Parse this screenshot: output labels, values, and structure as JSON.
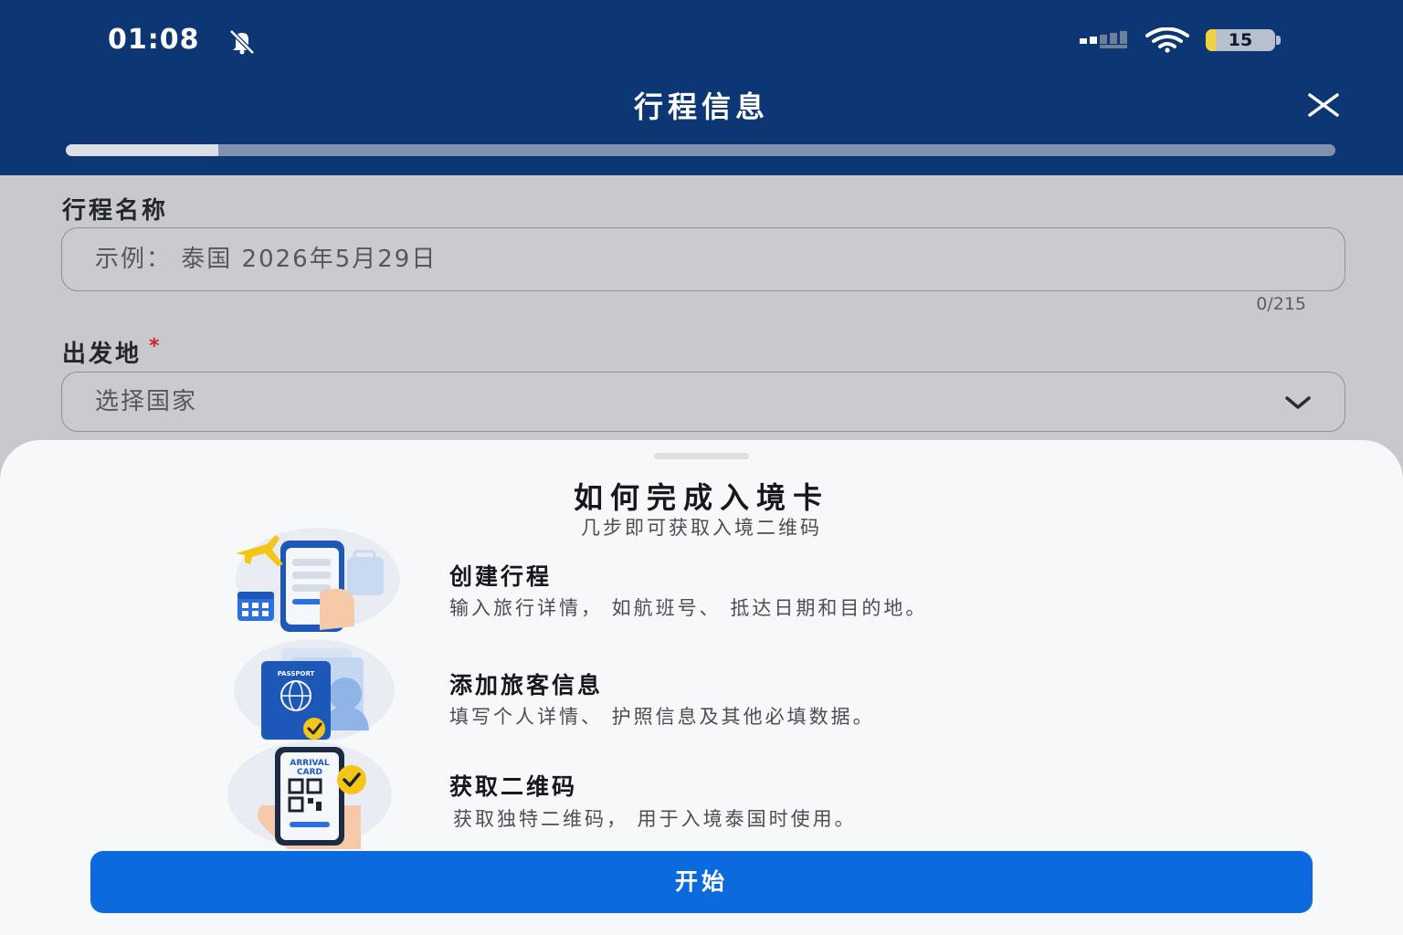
{
  "status_bar": {
    "time": "01:08",
    "battery_level": "15",
    "battery_fraction": 0.15
  },
  "header": {
    "title": "行程信息",
    "progress_fraction": 0.12
  },
  "form": {
    "trip_name": {
      "label": "行程名称",
      "placeholder": "示例： 泰国 2026年5月29日",
      "counter": "0/215"
    },
    "departure": {
      "label": "出发地",
      "required_mark": "*",
      "placeholder": "选择国家"
    }
  },
  "sheet": {
    "title": "如何完成入境卡",
    "subtitle": "几步即可获取入境二维码",
    "steps": [
      {
        "title": "创建行程",
        "description": "输入旅行详情， 如航班号、 抵达日期和目的地。"
      },
      {
        "title": "添加旅客信息",
        "description": "填写个人详情、 护照信息及其他必填数据。"
      },
      {
        "title": "获取二维码",
        "description": "获取独特二维码， 用于入境泰国时使用。"
      }
    ],
    "illustration_text": {
      "passport": "PASSPORT",
      "arrival_card_line1": "ARRIVAL",
      "arrival_card_line2": "CARD"
    },
    "start_label": "开始"
  },
  "colors": {
    "header_bg": "#0c3674",
    "primary_button": "#0b6bde",
    "battery_fill": "#f3d33b",
    "required": "#c8262c"
  }
}
